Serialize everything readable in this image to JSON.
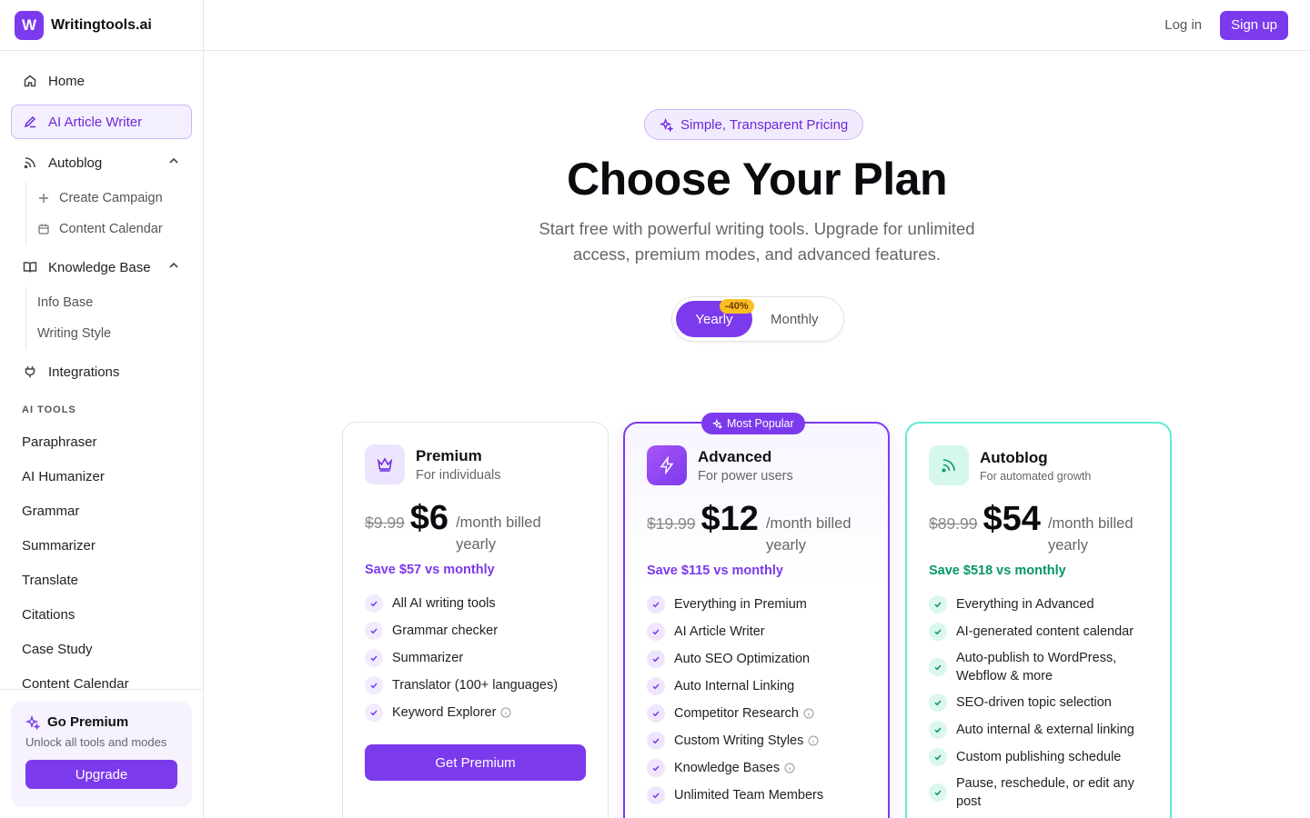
{
  "brand": {
    "logo_letter": "W",
    "name": "Writingtools.ai"
  },
  "sidebar": {
    "nav": {
      "home": "Home",
      "ai_article_writer": "AI Article Writer",
      "autoblog": "Autoblog",
      "autoblog_sub": [
        "Create Campaign",
        "Content Calendar"
      ],
      "knowledge_base": "Knowledge Base",
      "knowledge_sub": [
        "Info Base",
        "Writing Style"
      ],
      "integrations": "Integrations"
    },
    "tools_label": "AI TOOLS",
    "tools": [
      "Paraphraser",
      "AI Humanizer",
      "Grammar",
      "Summarizer",
      "Translate",
      "Citations",
      "Case Study",
      "Content Calendar"
    ],
    "premium": {
      "title": "Go Premium",
      "desc": "Unlock all tools and modes",
      "button": "Upgrade"
    }
  },
  "header": {
    "login": "Log in",
    "signup": "Sign up"
  },
  "hero": {
    "pill": "Simple, Transparent Pricing",
    "title": "Choose Your Plan",
    "subtitle": "Start free with powerful writing tools. Upgrade for unlimited access, premium modes, and advanced features."
  },
  "billing_toggle": {
    "yearly": "Yearly",
    "monthly": "Monthly",
    "discount": "-40%",
    "selected": "Yearly"
  },
  "plans": [
    {
      "name": "Premium",
      "for": "For individuals",
      "old_price": "$9.99",
      "price": "$6",
      "period": "/month billed yearly",
      "save": "Save $57 vs monthly",
      "features": [
        "All AI writing tools",
        "Grammar checker",
        "Summarizer",
        "Translator (100+ languages)",
        "Keyword Explorer"
      ],
      "cta": "Get Premium"
    },
    {
      "name": "Advanced",
      "for": "For power users",
      "badge": "Most Popular",
      "old_price": "$19.99",
      "price": "$12",
      "period": "/month billed yearly",
      "save": "Save $115 vs monthly",
      "features": [
        "Everything in Premium",
        "AI Article Writer",
        "Auto SEO Optimization",
        "Auto Internal Linking",
        "Competitor Research",
        "Custom Writing Styles",
        "Knowledge Bases",
        "Unlimited Team Members"
      ]
    },
    {
      "name": "Autoblog",
      "for": "For automated growth",
      "old_price": "$89.99",
      "price": "$54",
      "period": "/month billed yearly",
      "save": "Save $518 vs monthly",
      "features": [
        "Everything in Advanced",
        "AI-generated content calendar",
        "Auto-publish to WordPress, Webflow & more",
        "SEO-driven topic selection",
        "Auto internal & external linking",
        "Custom publishing schedule",
        "Pause, reschedule, or edit any post"
      ]
    }
  ],
  "colors": {
    "accent": "#7c3aed",
    "accent_light": "#f1ebfd",
    "green": "#059669",
    "teal_border": "#5eead4",
    "discount_badge": "#fbbf24"
  }
}
